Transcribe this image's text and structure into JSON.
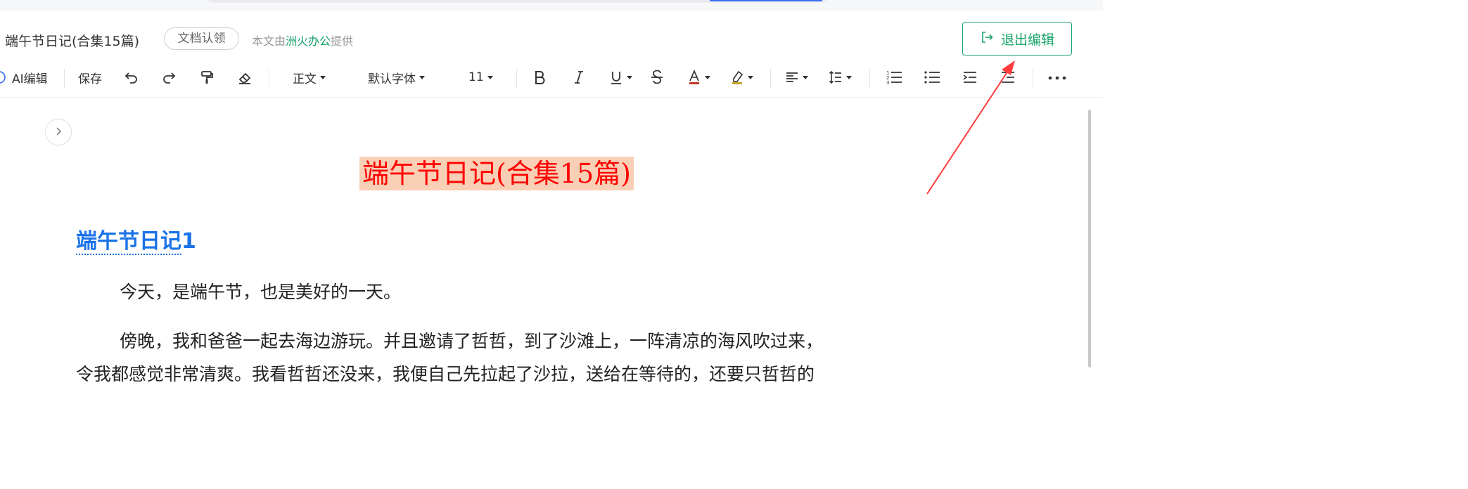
{
  "header": {
    "doc_name": "端午节日记(合集15篇)",
    "claim_badge": "文档认领",
    "provided_prefix": "本文由",
    "provided_brand": "洲火办公",
    "provided_suffix": "提供",
    "exit_label": "退出编辑"
  },
  "toolbar": {
    "ai_label": "AI编辑",
    "save_label": "保存",
    "style_value": "正文",
    "font_value": "默认字体",
    "size_value": "11"
  },
  "document": {
    "title": "端午节日记(合集15篇)",
    "heading_text": "端午节日记",
    "heading_number": "1",
    "paragraph_1": "今天，是端午节，也是美好的一天。",
    "paragraph_2": "傍晚，我和爸爸一起去海边游玩。并且邀请了哲哲，到了沙滩上，一阵清凉的海风吹过来，",
    "paragraph_3": "令我都感觉非常清爽。我看哲哲还没来，我便自己先拉起了沙拉，送给在等待的，还要只哲哲的"
  },
  "colors": {
    "brand_green": "#16a36a",
    "title_red": "#ff0000",
    "title_highlight": "#f9cfb5",
    "heading_blue": "#1a73e8",
    "annotation_arrow": "#ff3b3b"
  }
}
